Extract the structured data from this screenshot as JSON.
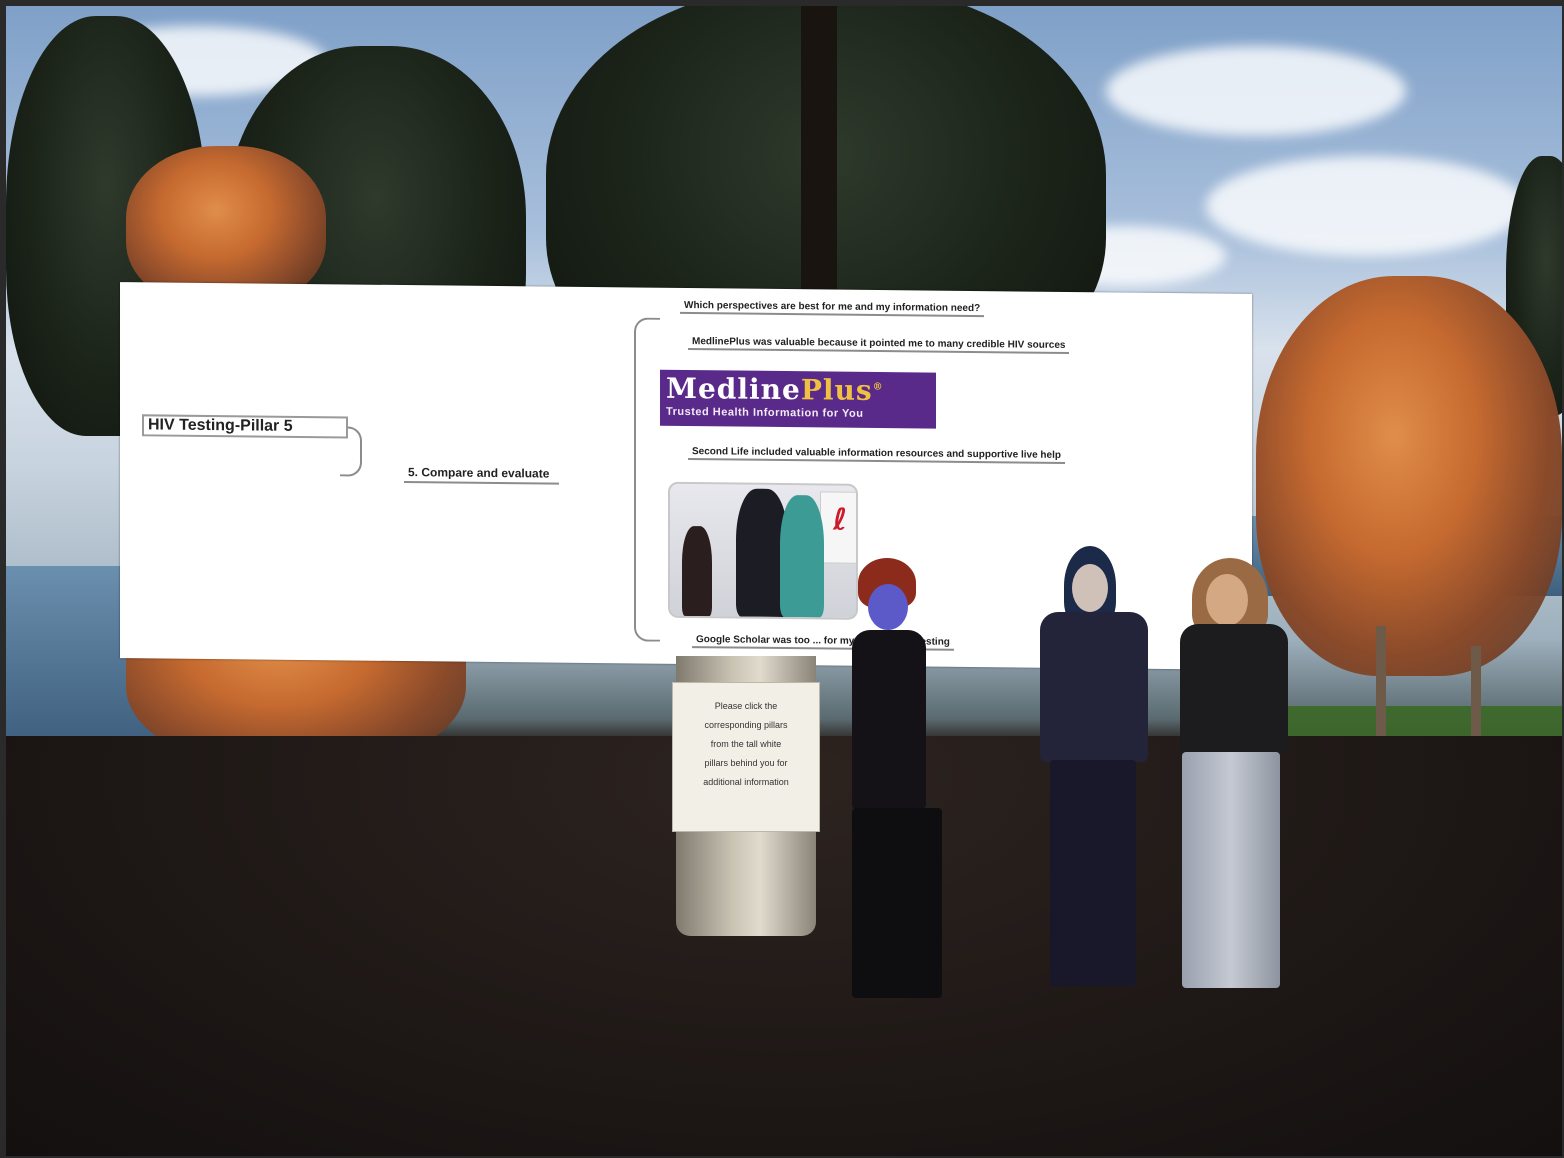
{
  "mindmap": {
    "root": "HIV Testing-Pillar 5",
    "branch": "5. Compare and evaluate",
    "leaves": [
      "Which perspectives are best for me and my information need?",
      "MedlinePlus was valuable because it pointed me to many credible HIV sources",
      "Second Life included valuable information resources and supportive live help",
      "Google Scholar was too ... for my informatio... testing"
    ],
    "medlineplus": {
      "name_a": "Medline",
      "name_b": "Plus",
      "reg": "®",
      "tagline": "Trusted Health Information for You"
    }
  },
  "pillar_sign": {
    "lines": [
      "Please click the",
      "corresponding pillars",
      "from the tall white",
      "pillars behind you for",
      "additional information"
    ]
  },
  "colors": {
    "medline_bg": "#5a2a8a",
    "medline_accent": "#f0c040",
    "ribbon": "#cc1c2c"
  }
}
